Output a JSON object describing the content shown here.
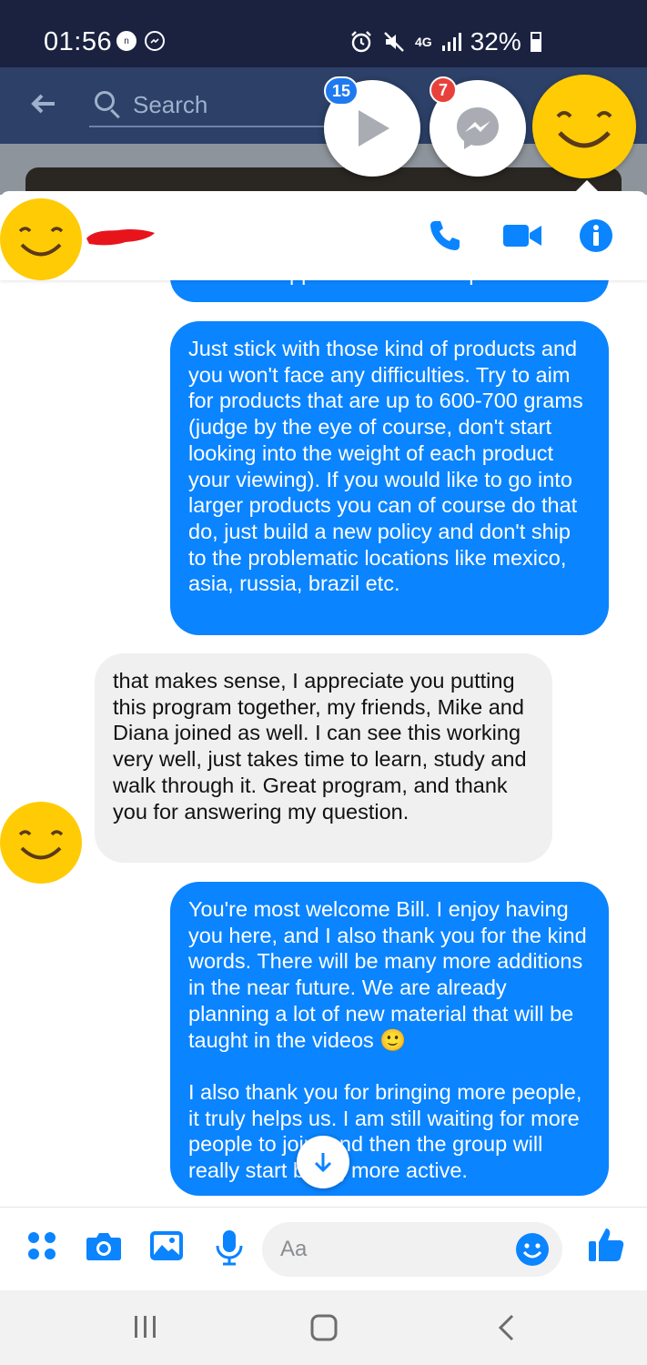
{
  "status_bar": {
    "time": "01:56",
    "network": "4G",
    "battery": "32%"
  },
  "search": {
    "placeholder": "Search"
  },
  "chat_heads": {
    "video_badge": "15",
    "messenger_badge": "7"
  },
  "colors": {
    "accent": "#0a84ff",
    "avatar_yellow": "#ffcb05",
    "incoming_bubble": "#f0f0f0"
  },
  "header": {
    "icons": [
      "phone-icon",
      "video-camera-icon",
      "info-icon"
    ]
  },
  "messages": [
    {
      "direction": "outgoing",
      "text": "another supplier that does ship to Brazil."
    },
    {
      "direction": "outgoing",
      "text": "Just stick with those kind of products and you won't face any difficulties. Try to aim for products that are up to 600-700 grams (judge by the eye of course, don't start looking into the weight of each product your viewing). If you would like to go into larger products you can of course do that do, just build a new policy and don't ship to the problematic locations like mexico, asia, russia, brazil etc."
    },
    {
      "direction": "incoming",
      "text": "that makes sense, I appreciate you putting this program together, my friends, Mike and Diana joined as well. I can see this working very well, just takes time to learn, study and walk through it. Great program, and thank you for answering my question."
    },
    {
      "direction": "outgoing",
      "text": "You're most welcome Bill. I enjoy having you here, and I also thank you for the kind words. There will be many more additions in the near future. We are already planning a lot of new material that will be taught in the videos 🙂\n\nI also thank you for bringing more people, it truly helps us. I am still waiting for more people to join, and then the group will really start being more active."
    }
  ],
  "composer": {
    "placeholder": "Aa",
    "icons": [
      "apps-icon",
      "camera-icon",
      "gallery-icon",
      "microphone-icon",
      "emoji-icon",
      "thumbs-up-icon"
    ]
  },
  "nav": {
    "icons": [
      "recents-icon",
      "home-icon",
      "back-icon"
    ]
  }
}
